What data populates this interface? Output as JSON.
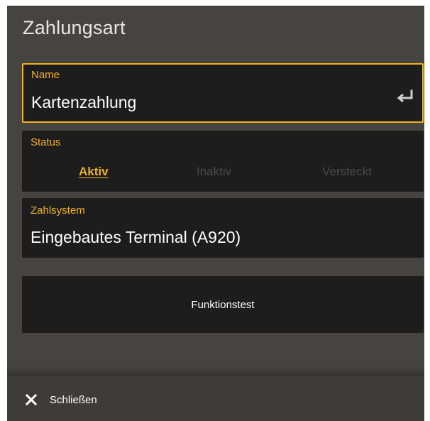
{
  "dialog": {
    "title": "Zahlungsart"
  },
  "name_field": {
    "label": "Name",
    "value": "Kartenzahlung",
    "icon": "enter-return-icon"
  },
  "status_field": {
    "label": "Status",
    "options": [
      "Aktiv",
      "Inaktiv",
      "Versteckt"
    ],
    "selected": "Aktiv"
  },
  "zahlsystem_field": {
    "label": "Zahlsystem",
    "value": "Eingebautes Terminal (A920)"
  },
  "test_button": {
    "label": "Funktionstest"
  },
  "footer": {
    "close_label": "Schließen",
    "close_icon": "close-icon"
  },
  "colors": {
    "accent": "#f2b11c",
    "dialog_bg": "#454441",
    "field_bg": "#1d1d1d",
    "inactive_text": "#4a4a4a"
  }
}
